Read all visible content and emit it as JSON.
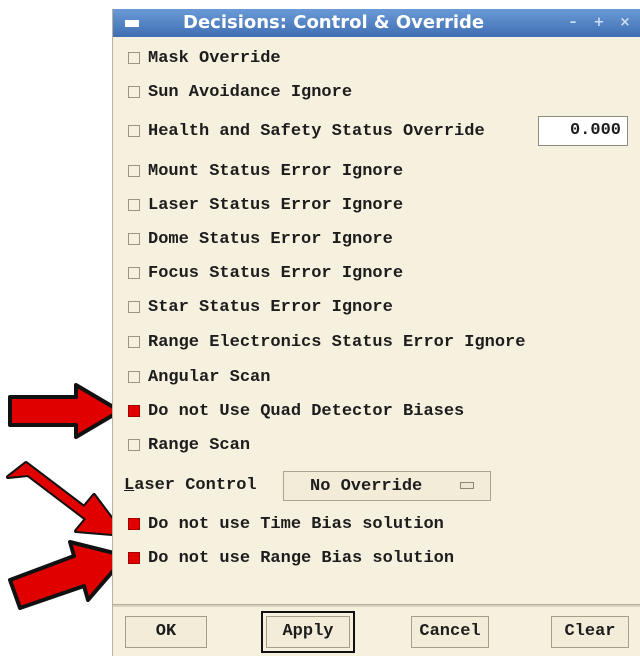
{
  "window": {
    "title": "Decisions: Control & Override",
    "title_buttons": [
      "–",
      "+",
      "×"
    ]
  },
  "options": [
    {
      "label": "Mask Override",
      "checked": false
    },
    {
      "label": "Sun Avoidance Ignore",
      "checked": false
    },
    {
      "label": "Health and Safety Status Override",
      "checked": false
    },
    {
      "label": "Mount Status Error Ignore",
      "checked": false
    },
    {
      "label": "Laser Status Error Ignore",
      "checked": false
    },
    {
      "label": "Dome Status Error Ignore",
      "checked": false
    },
    {
      "label": "Focus Status Error Ignore",
      "checked": false
    },
    {
      "label": "Star Status Error Ignore",
      "checked": false
    },
    {
      "label": "Range Electronics Status Error Ignore",
      "checked": false
    },
    {
      "label": "Angular Scan",
      "checked": false
    },
    {
      "label": "Do not Use Quad Detector Biases",
      "checked": true
    },
    {
      "label": "Range Scan",
      "checked": false
    },
    {
      "label": "Do not use Time Bias solution",
      "checked": true
    },
    {
      "label": "Do not use Range Bias solution",
      "checked": true
    }
  ],
  "health_override_value": "0.000",
  "laser_control": {
    "label_first": "L",
    "label_rest": "aser Control",
    "selected": "No Override"
  },
  "buttons": {
    "ok": "OK",
    "apply": "Apply",
    "cancel": "Cancel",
    "clear": "Clear"
  },
  "colors": {
    "checked": "#e00000",
    "arrow_fill": "#e00000",
    "title_bar": "#4a7cc0",
    "panel_bg": "#f6f0de"
  }
}
